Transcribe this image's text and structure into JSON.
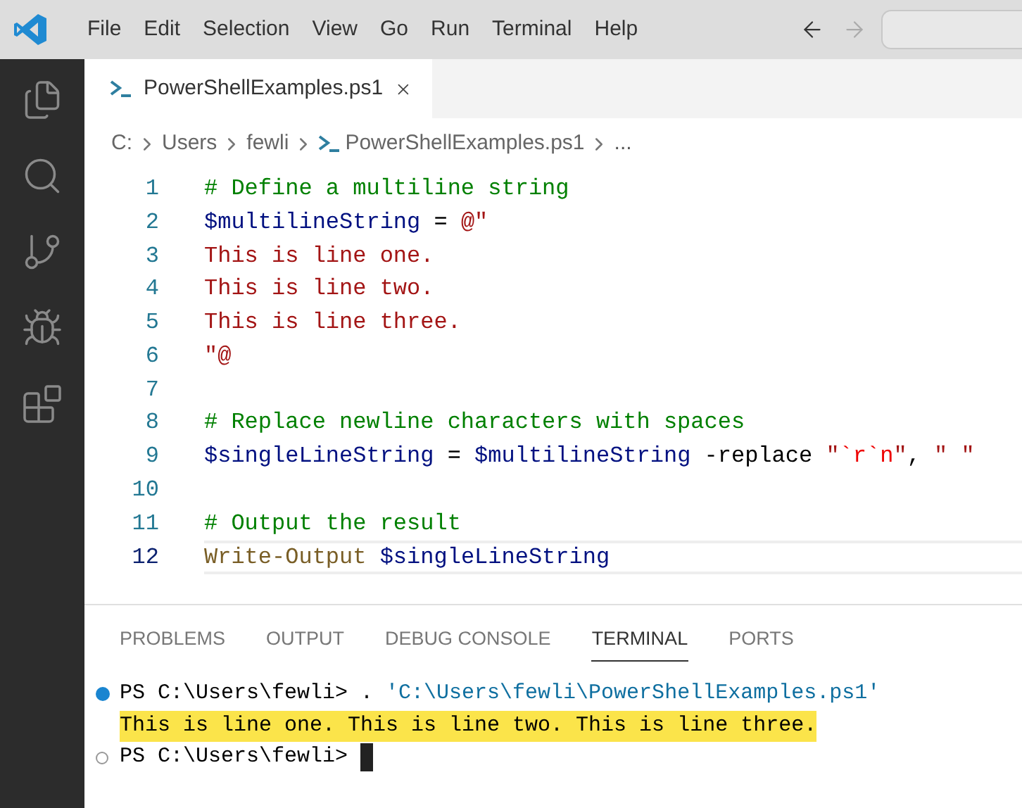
{
  "menu_bar": {
    "items": [
      "File",
      "Edit",
      "Selection",
      "View",
      "Go",
      "Run",
      "Terminal",
      "Help"
    ],
    "nav_buttons": [
      {
        "kind": "back",
        "disabled": false
      },
      {
        "kind": "forward",
        "disabled": true
      }
    ]
  },
  "activity_bar": {
    "items": [
      {
        "kind": "explorer"
      },
      {
        "kind": "search"
      },
      {
        "kind": "source-control"
      },
      {
        "kind": "run-debug"
      },
      {
        "kind": "extensions"
      }
    ]
  },
  "editor_tabs": [
    {
      "label": "PowerShellExamples.ps1",
      "selected": true
    }
  ],
  "breadcrumb": [
    {
      "kind": "folder",
      "text": "C:"
    },
    {
      "kind": "folder",
      "text": "Users"
    },
    {
      "kind": "folder",
      "text": "fewli"
    },
    {
      "kind": "file",
      "text": "PowerShellExamples.ps1"
    },
    {
      "kind": "more",
      "text": "..."
    }
  ],
  "code_lines": [
    {
      "number": "1",
      "current": false,
      "tokens": [
        {
          "kind": "comment",
          "text": "# Define a multiline string"
        }
      ]
    },
    {
      "number": "2",
      "current": false,
      "tokens": [
        {
          "kind": "variable",
          "text": "$multilineString"
        },
        {
          "kind": "plain",
          "text": " = "
        },
        {
          "kind": "string",
          "text": "@\""
        }
      ]
    },
    {
      "number": "3",
      "current": false,
      "tokens": [
        {
          "kind": "string",
          "text": "This is line one."
        }
      ]
    },
    {
      "number": "4",
      "current": false,
      "tokens": [
        {
          "kind": "string",
          "text": "This is line two."
        }
      ]
    },
    {
      "number": "5",
      "current": false,
      "tokens": [
        {
          "kind": "string",
          "text": "This is line three."
        }
      ]
    },
    {
      "number": "6",
      "current": false,
      "tokens": [
        {
          "kind": "string",
          "text": "\"@"
        }
      ]
    },
    {
      "number": "7",
      "current": false
    },
    {
      "number": "8",
      "current": false,
      "tokens": [
        {
          "kind": "comment",
          "text": "# Replace newline characters with spaces"
        }
      ]
    },
    {
      "number": "9",
      "current": false,
      "tokens": [
        {
          "kind": "variable",
          "text": "$singleLineString"
        },
        {
          "kind": "plain",
          "text": " = "
        },
        {
          "kind": "variable",
          "text": "$multilineString"
        },
        {
          "kind": "plain",
          "text": " -replace "
        },
        {
          "kind": "string",
          "text": "\""
        },
        {
          "kind": "escape",
          "text": "`r`n"
        },
        {
          "kind": "string",
          "text": "\""
        },
        {
          "kind": "plain",
          "text": ", "
        },
        {
          "kind": "string",
          "text": "\" \""
        }
      ]
    },
    {
      "number": "10",
      "current": false
    },
    {
      "number": "11",
      "current": false,
      "tokens": [
        {
          "kind": "comment",
          "text": "# Output the result"
        }
      ]
    },
    {
      "number": "12",
      "current": true,
      "tokens": [
        {
          "kind": "function",
          "text": "Write-Output "
        },
        {
          "kind": "variable",
          "text": "$singleLineString"
        }
      ]
    }
  ],
  "panel_tabs": [
    {
      "label": "PROBLEMS",
      "selected": false
    },
    {
      "label": "OUTPUT",
      "selected": false
    },
    {
      "label": "DEBUG CONSOLE",
      "selected": false
    },
    {
      "label": "TERMINAL",
      "selected": true
    },
    {
      "label": "PORTS",
      "selected": false
    }
  ],
  "terminal_lines": [
    {
      "kind": "succeeded",
      "highlighted": false,
      "cursor": false,
      "tokens": [
        {
          "kind": "plain",
          "text": "PS C:\\Users\\fewli> . "
        },
        {
          "kind": "path",
          "text": "'C:\\Users\\fewli\\PowerShellExamples.ps1'"
        }
      ]
    },
    {
      "kind": "output",
      "highlighted": true,
      "cursor": false,
      "tokens": [
        {
          "kind": "plain",
          "text": "This is line one. This is line two. This is line three."
        }
      ]
    },
    {
      "kind": "pending",
      "highlighted": false,
      "cursor": true,
      "tokens": [
        {
          "kind": "plain",
          "text": "PS C:\\Users\\fewli> "
        }
      ]
    }
  ]
}
